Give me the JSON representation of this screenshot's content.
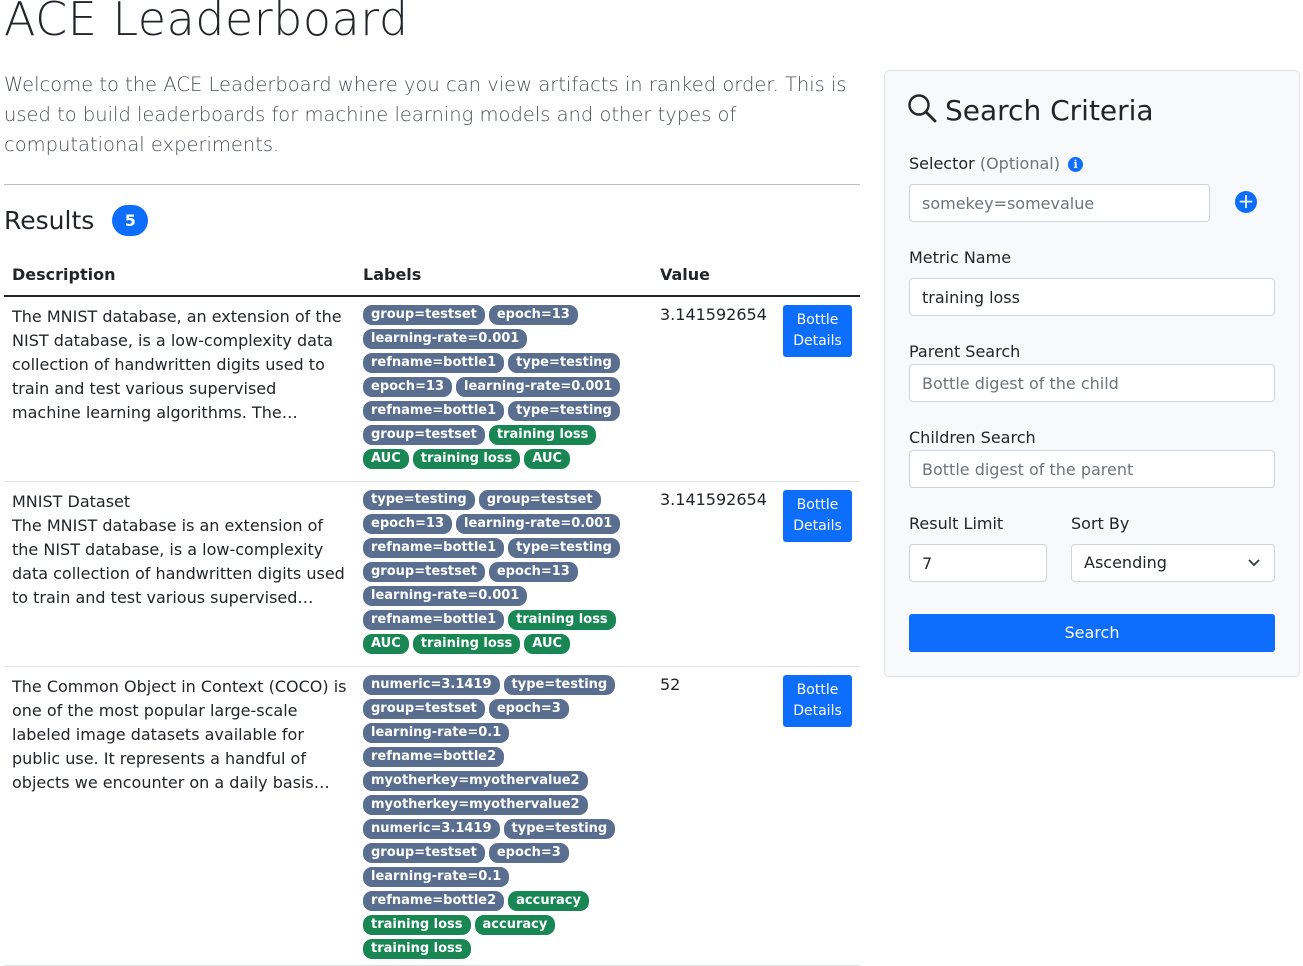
{
  "page": {
    "title": "ACE Leaderboard",
    "intro": "Welcome to the ACE Leaderboard where you can view artifacts in ranked order. This is used to build leaderboards for machine learning models and other types of computational experiments."
  },
  "results": {
    "heading": "Results",
    "count": "5",
    "columns": {
      "description": "Description",
      "labels": "Labels",
      "value": "Value"
    },
    "button_label": "Bottle Details",
    "rows": [
      {
        "description": "The MNIST database, an extension of the NIST database, is a low-complexity data collection of handwritten digits used to train and test various supervised machine learning algorithms. The…",
        "value": "3.141592654",
        "labels": [
          {
            "text": "group=testset",
            "kind": "key"
          },
          {
            "text": "epoch=13",
            "kind": "key"
          },
          {
            "text": "learning-rate=0.001",
            "kind": "key"
          },
          {
            "text": "refname=bottle1",
            "kind": "key"
          },
          {
            "text": "type=testing",
            "kind": "key"
          },
          {
            "text": "epoch=13",
            "kind": "key"
          },
          {
            "text": "learning-rate=0.001",
            "kind": "key"
          },
          {
            "text": "refname=bottle1",
            "kind": "key"
          },
          {
            "text": "type=testing",
            "kind": "key"
          },
          {
            "text": "group=testset",
            "kind": "key"
          },
          {
            "text": "training loss",
            "kind": "metric"
          },
          {
            "text": "AUC",
            "kind": "metric"
          },
          {
            "text": "training loss",
            "kind": "metric"
          },
          {
            "text": "AUC",
            "kind": "metric"
          }
        ]
      },
      {
        "title": "MNIST Dataset",
        "description": "The MNIST database is an extension of the NIST database, is a low-complexity data collection of handwritten digits used to train and test various supervised…",
        "value": "3.141592654",
        "labels": [
          {
            "text": "type=testing",
            "kind": "key"
          },
          {
            "text": "group=testset",
            "kind": "key"
          },
          {
            "text": "epoch=13",
            "kind": "key"
          },
          {
            "text": "learning-rate=0.001",
            "kind": "key"
          },
          {
            "text": "refname=bottle1",
            "kind": "key"
          },
          {
            "text": "type=testing",
            "kind": "key"
          },
          {
            "text": "group=testset",
            "kind": "key"
          },
          {
            "text": "epoch=13",
            "kind": "key"
          },
          {
            "text": "learning-rate=0.001",
            "kind": "key"
          },
          {
            "text": "refname=bottle1",
            "kind": "key"
          },
          {
            "text": "training loss",
            "kind": "metric"
          },
          {
            "text": "AUC",
            "kind": "metric"
          },
          {
            "text": "training loss",
            "kind": "metric"
          },
          {
            "text": "AUC",
            "kind": "metric"
          }
        ]
      },
      {
        "description": "The Common Object in Context (COCO) is one of the most popular large-scale labeled image datasets available for public use. It represents a handful of objects we encounter on a daily basis…",
        "value": "52",
        "labels": [
          {
            "text": "numeric=3.1419",
            "kind": "key"
          },
          {
            "text": "type=testing",
            "kind": "key"
          },
          {
            "text": "group=testset",
            "kind": "key"
          },
          {
            "text": "epoch=3",
            "kind": "key"
          },
          {
            "text": "learning-rate=0.1",
            "kind": "key"
          },
          {
            "text": "refname=bottle2",
            "kind": "key"
          },
          {
            "text": "myotherkey=myothervalue2",
            "kind": "key"
          },
          {
            "text": "myotherkey=myothervalue2",
            "kind": "key"
          },
          {
            "text": "numeric=3.1419",
            "kind": "key"
          },
          {
            "text": "type=testing",
            "kind": "key"
          },
          {
            "text": "group=testset",
            "kind": "key"
          },
          {
            "text": "epoch=3",
            "kind": "key"
          },
          {
            "text": "learning-rate=0.1",
            "kind": "key"
          },
          {
            "text": "refname=bottle2",
            "kind": "key"
          },
          {
            "text": "accuracy",
            "kind": "metric"
          },
          {
            "text": "training loss",
            "kind": "metric"
          },
          {
            "text": "accuracy",
            "kind": "metric"
          },
          {
            "text": "training loss",
            "kind": "metric"
          }
        ]
      }
    ]
  },
  "search": {
    "title": "Search Criteria",
    "selector_label": "Selector",
    "selector_optional": "(Optional)",
    "selector_placeholder": "somekey=somevalue",
    "metric_label": "Metric Name",
    "metric_value": "training loss",
    "parent_label": "Parent Search",
    "parent_placeholder": "Bottle digest of the child",
    "children_label": "Children Search",
    "children_placeholder": "Bottle digest of the parent",
    "limit_label": "Result Limit",
    "limit_value": "7",
    "sort_label": "Sort By",
    "sort_value": "Ascending",
    "submit_label": "Search"
  },
  "colors": {
    "primary": "#0d6efd",
    "label_key": "#5a6f8f",
    "label_metric": "#198754"
  }
}
